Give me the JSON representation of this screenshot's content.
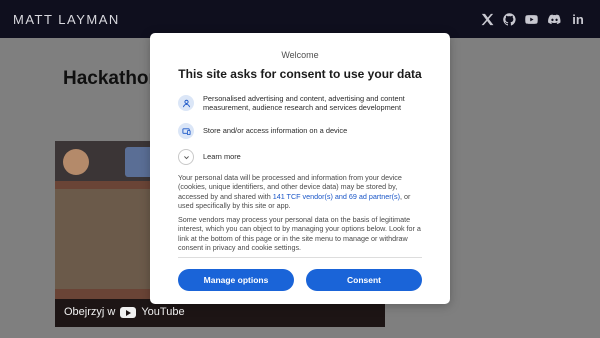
{
  "header": {
    "brand": "MATT LAYMAN",
    "social": [
      "x-icon",
      "github-icon",
      "youtube-icon",
      "discord-icon",
      "linkedin-icon"
    ],
    "linkedin_text": "in"
  },
  "page": {
    "title": "Hackathon",
    "video": {
      "watch_label": "Obejrzyj w",
      "platform": "YouTube"
    }
  },
  "dialog": {
    "welcome": "Welcome",
    "heading": "This site asks for consent to use your data",
    "purposes": [
      {
        "icon": "person-icon",
        "text": "Personalised advertising and content, advertising and content measurement, audience research and services development"
      },
      {
        "icon": "device-icon",
        "text": "Store and/or access information on a device"
      },
      {
        "icon": "chevron-down-icon",
        "text": "Learn more"
      }
    ],
    "paragraph1_before": "Your personal data will be processed and information from your device (cookies, unique identifiers, and other device data) may be stored by, accessed by and shared with ",
    "paragraph1_link": "141 TCF vendor(s) and 69 ad partner(s)",
    "paragraph1_after": ", or used specifically by this site or app.",
    "paragraph2": "Some vendors may process your personal data on the basis of legitimate interest, which you can object to by managing your options below. Look for a link at the bottom of this page or in the site menu to manage or withdraw consent in privacy and cookie settings.",
    "manage_label": "Manage options",
    "consent_label": "Consent"
  },
  "colors": {
    "header_bg": "#0f0f1e",
    "overlay": "#7f7f7f",
    "accent": "#1a64d8",
    "link": "#1a56c7"
  }
}
